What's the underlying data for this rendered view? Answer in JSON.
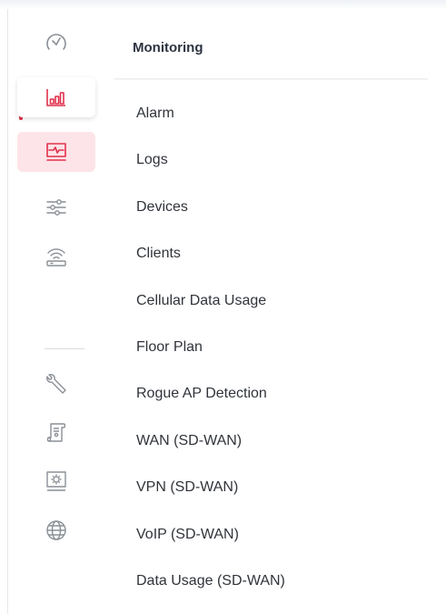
{
  "rail": {
    "items": [
      {
        "icon": "speedometer-icon"
      },
      {
        "icon": "bar-chart-icon"
      },
      {
        "icon": "monitor-pulse-icon"
      },
      {
        "icon": "sliders-icon"
      },
      {
        "icon": "wifi-router-icon"
      },
      {
        "icon": "wrench-icon"
      },
      {
        "icon": "scroll-certificate-icon"
      },
      {
        "icon": "gear-screen-icon"
      },
      {
        "icon": "globe-icon"
      }
    ],
    "accent_color": "#e0314b",
    "active_bg": "#fde4e8"
  },
  "panel": {
    "title": "Monitoring",
    "items": [
      {
        "label": "Alarm"
      },
      {
        "label": "Logs"
      },
      {
        "label": "Devices"
      },
      {
        "label": "Clients"
      },
      {
        "label": "Cellular Data Usage"
      },
      {
        "label": "Floor Plan"
      },
      {
        "label": "Rogue AP Detection"
      },
      {
        "label": "WAN (SD-WAN)"
      },
      {
        "label": "VPN (SD-WAN)"
      },
      {
        "label": "VoIP (SD-WAN)"
      },
      {
        "label": "Data Usage (SD-WAN)"
      }
    ]
  }
}
